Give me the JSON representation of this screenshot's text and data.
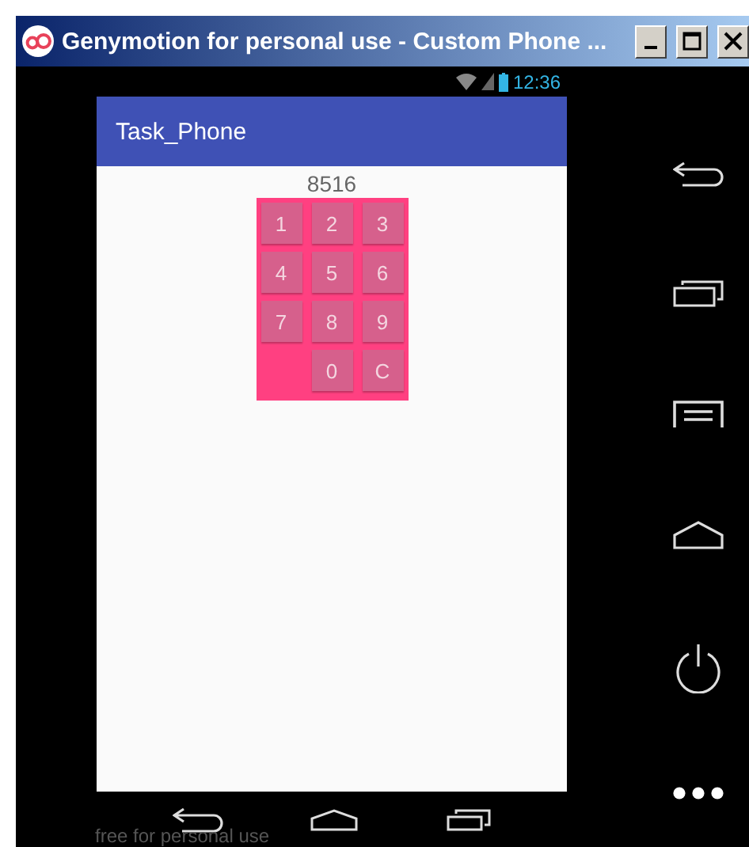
{
  "window": {
    "title": "Genymotion for personal use - Custom Phone ..."
  },
  "status_bar": {
    "time": "12:36"
  },
  "app_bar": {
    "title": "Task_Phone"
  },
  "display": {
    "value": "8516"
  },
  "keypad": [
    {
      "kind": "key",
      "label": "1"
    },
    {
      "kind": "key",
      "label": "2"
    },
    {
      "kind": "key",
      "label": "3"
    },
    {
      "kind": "key",
      "label": "4"
    },
    {
      "kind": "key",
      "label": "5"
    },
    {
      "kind": "key",
      "label": "6"
    },
    {
      "kind": "key",
      "label": "7"
    },
    {
      "kind": "key",
      "label": "8"
    },
    {
      "kind": "key",
      "label": "9"
    },
    {
      "kind": "spacer"
    },
    {
      "kind": "key",
      "label": "0"
    },
    {
      "kind": "key",
      "label": "C"
    }
  ],
  "overlay_text": "free for personal use"
}
